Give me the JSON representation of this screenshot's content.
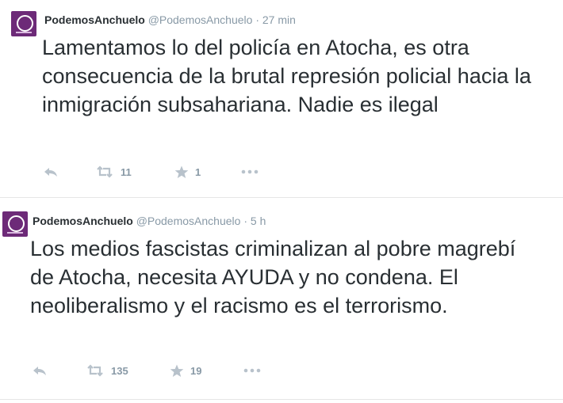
{
  "tweets": [
    {
      "name": "PodemosAnchuelo",
      "handle": "@PodemosAnchuelo",
      "sep": "·",
      "time": "27 min",
      "text": "Lamentamos lo del policía en Atocha, es otra consecuencia de la brutal represión policial hacia la inmigración subsahariana. Nadie es ilegal",
      "retweets": "11",
      "favorites": "1"
    },
    {
      "name": "PodemosAnchuelo",
      "handle": "@PodemosAnchuelo",
      "sep": "·",
      "time": "5 h",
      "text": "Los medios fascistas criminalizan al pobre magrebí de Atocha, necesita AYUDA y no condena. El neoliberalismo y el racismo es el terrorismo.",
      "retweets": "135",
      "favorites": "19"
    }
  ],
  "colors": {
    "brand": "#6d2a78",
    "meta": "#8899a6",
    "text": "#292f33"
  },
  "icons": [
    "reply-icon",
    "retweet-icon",
    "favorite-star-icon",
    "more-dots-icon"
  ]
}
